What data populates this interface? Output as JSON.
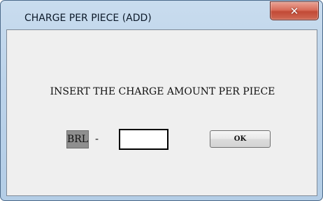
{
  "window": {
    "title": "CHARGE PER PIECE (ADD)",
    "close_icon": "close-x-icon"
  },
  "dialog": {
    "prompt": "INSERT THE CHARGE AMOUNT PER PIECE",
    "currency_code": "BRL",
    "separator": "-",
    "amount_value": "",
    "ok_label": "OK"
  },
  "colors": {
    "frame": "#bcd3ea",
    "client": "#efefef",
    "close_button": "#c24a36",
    "currency_box": "#8f8f8f"
  }
}
